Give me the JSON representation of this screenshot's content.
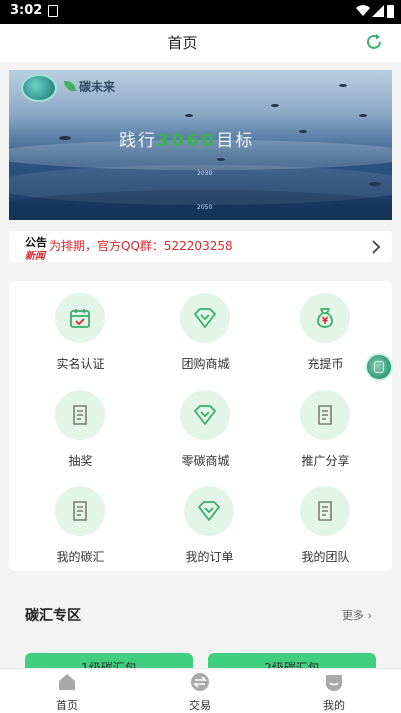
{
  "status_bar": {
    "time": "3:02",
    "sim_label": "SIM"
  },
  "header": {
    "title": "首页"
  },
  "banner": {
    "brand": "碳未来",
    "slogan_prefix": "践行",
    "slogan_number": "3060",
    "slogan_suffix": "目标",
    "years": [
      "2030",
      "2050"
    ]
  },
  "notice": {
    "tag_top": "公告",
    "tag_bottom": "新闻",
    "text": "为排期，官方QQ群：522203258"
  },
  "grid": {
    "items": [
      {
        "label": "实名认证",
        "icon": "calendar-check-icon"
      },
      {
        "label": "团购商城",
        "icon": "diamond-icon"
      },
      {
        "label": "充提币",
        "icon": "money-bag-icon"
      },
      {
        "label": "抽奖",
        "icon": "document-icon"
      },
      {
        "label": "零碳商城",
        "icon": "diamond-icon"
      },
      {
        "label": "推广分享",
        "icon": "document-icon"
      },
      {
        "label": "我的碳汇",
        "icon": "document-icon"
      },
      {
        "label": "我的订单",
        "icon": "diamond-icon"
      },
      {
        "label": "我的团队",
        "icon": "document-icon"
      }
    ]
  },
  "carbon_section": {
    "title": "碳汇专区",
    "more": "更多",
    "packs": [
      "1级碳汇包",
      "2级碳汇包"
    ]
  },
  "bottom_nav": {
    "items": [
      {
        "label": "首页",
        "icon": "home-icon"
      },
      {
        "label": "交易",
        "icon": "exchange-icon"
      },
      {
        "label": "我的",
        "icon": "profile-icon"
      }
    ]
  },
  "colors": {
    "accent": "#3fcf7e",
    "notice_red": "#e0262c",
    "icon_green": "#3ab06a",
    "icon_bg": "#e3f4e8"
  }
}
